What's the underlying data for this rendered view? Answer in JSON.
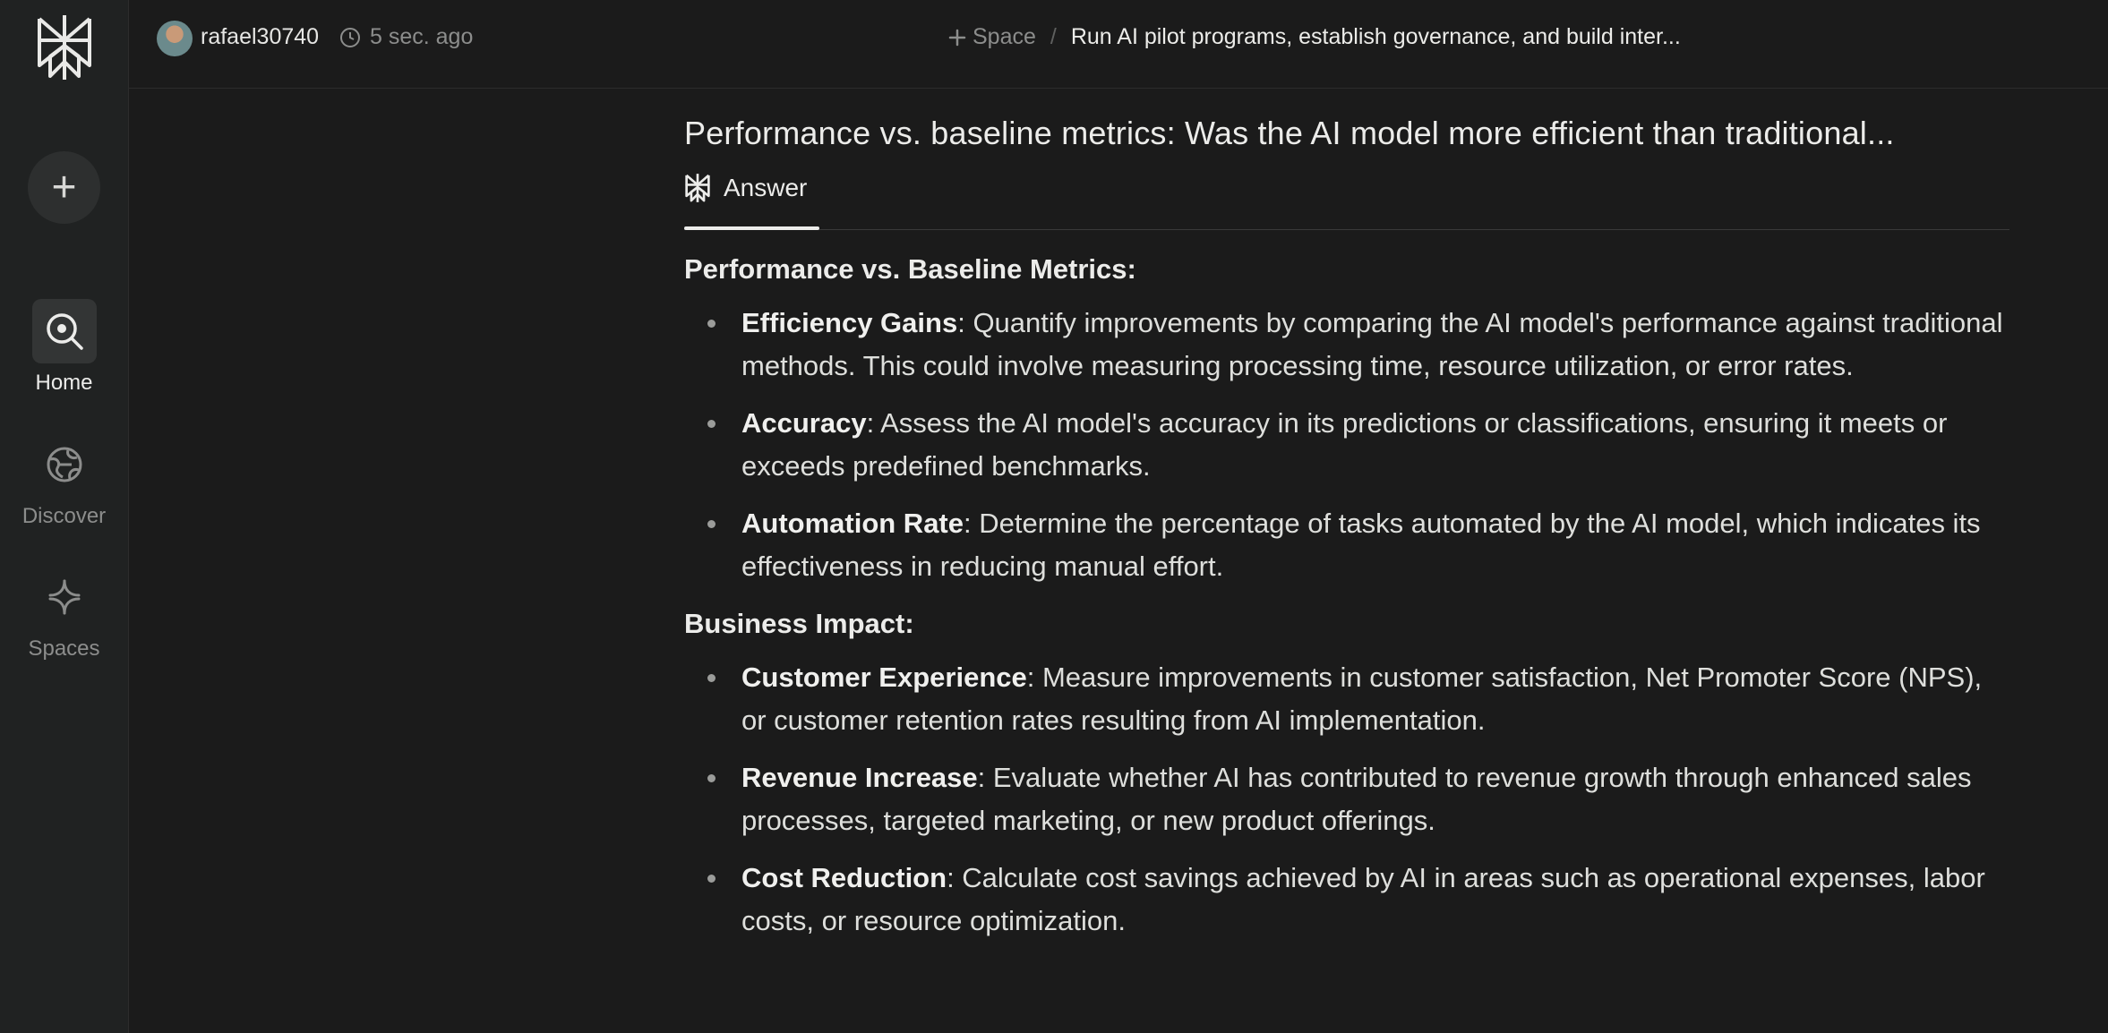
{
  "topbar": {
    "username": "rafael30740",
    "time": "5 sec. ago",
    "space_label": "Space",
    "separator": "/",
    "thread_title": "Run AI pilot programs, establish governance, and build inter..."
  },
  "sidebar": {
    "new_button": "+",
    "items": [
      {
        "label": "Home",
        "icon": "home-search-icon",
        "active": true
      },
      {
        "label": "Discover",
        "icon": "globe-icon",
        "active": false
      },
      {
        "label": "Spaces",
        "icon": "sparkle-icon",
        "active": false
      }
    ]
  },
  "main": {
    "question": "Performance vs. baseline metrics: Was the AI model more efficient than traditional...",
    "tab_label": "Answer",
    "sections": [
      {
        "heading": "Performance vs. Baseline Metrics:",
        "items": [
          {
            "term": "Efficiency Gains",
            "text": ": Quantify improvements by comparing the AI model's performance against traditional methods. This could involve measuring processing time, resource utilization, or error rates."
          },
          {
            "term": "Accuracy",
            "text": ": Assess the AI model's accuracy in its predictions or classifications, ensuring it meets or exceeds predefined benchmarks."
          },
          {
            "term": "Automation Rate",
            "text": ": Determine the percentage of tasks automated by the AI model, which indicates its effectiveness in reducing manual effort."
          }
        ]
      },
      {
        "heading": "Business Impact:",
        "items": [
          {
            "term": "Customer Experience",
            "text": ": Measure improvements in customer satisfaction, Net Promoter Score (NPS), or customer retention rates resulting from AI implementation."
          },
          {
            "term": "Revenue Increase",
            "text": ": Evaluate whether AI has contributed to revenue growth through enhanced sales processes, targeted marketing, or new product offerings."
          },
          {
            "term": "Cost Reduction",
            "text": ": Calculate cost savings achieved by AI in areas such as operational expenses, labor costs, or resource optimization."
          }
        ]
      }
    ]
  }
}
